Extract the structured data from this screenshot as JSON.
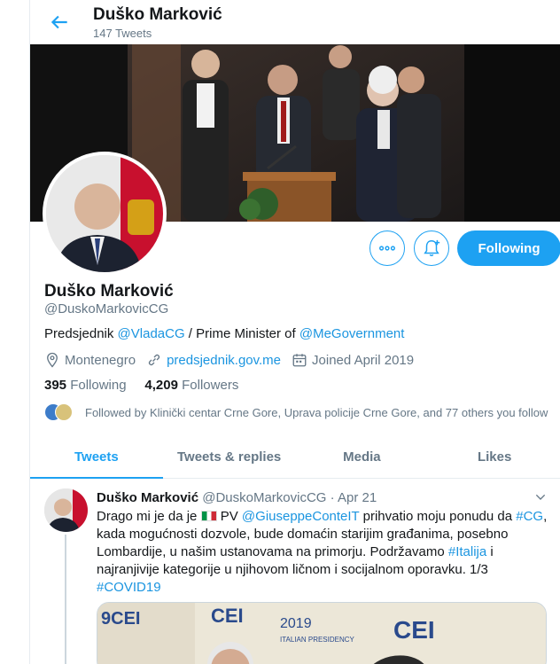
{
  "header": {
    "name": "Duško Marković",
    "tweet_count": "147 Tweets"
  },
  "profile": {
    "name": "Duško Marković",
    "handle": "@DuskoMarkovicCG",
    "bio_prefix": "Predsjednik ",
    "bio_link1": "@VladaCG",
    "bio_middle": " / Prime Minister of ",
    "bio_link2": "@MeGovernment",
    "location": "Montenegro",
    "website": "predsjednik.gov.me",
    "joined": "Joined April 2019",
    "following_count": "395",
    "following_label": "Following",
    "followers_count": "4,209",
    "followers_label": "Followers",
    "followed_by": "Followed by Klinički centar Crne Gore, Uprava policije Crne Gore, and 77 others you follow"
  },
  "actions": {
    "more_icon": "more-icon",
    "bell_icon": "bell-plus-icon",
    "follow_label": "Following"
  },
  "tabs": [
    {
      "label": "Tweets",
      "active": true
    },
    {
      "label": "Tweets & replies",
      "active": false
    },
    {
      "label": "Media",
      "active": false
    },
    {
      "label": "Likes",
      "active": false
    }
  ],
  "tweet": {
    "name": "Duško Marković",
    "handle_date": "@DuskoMarkovicCG · Apr 21",
    "text_1": "Drago mi je da je ",
    "text_2": " PV ",
    "mention": "@GiuseppeConteIT",
    "text_3": " prihvatio moju ponudu da ",
    "tag_cg": "#CG",
    "text_4": ", kada mogućnosti dozvole, bude domaćin starijim građanima, posebno Lombardije, u našim ustanovama na primorju. Podržavamo ",
    "tag_italija": "#Italija",
    "text_5": " i najranjivije kategorije u njihovom ličnom i socijalnom oporavku. 1/3 ",
    "tag_covid": "#COVID19",
    "media_texts": {
      "cei_1": "9CEI",
      "cei_2": "CEI",
      "year": "2019",
      "cei_3": "CEI",
      "presidency": "ITALIAN PRESIDENCY"
    }
  },
  "colors": {
    "accent": "#1da1f2",
    "link": "#1b95e0",
    "secondary_text": "#657786",
    "border": "#e6ecf0"
  }
}
